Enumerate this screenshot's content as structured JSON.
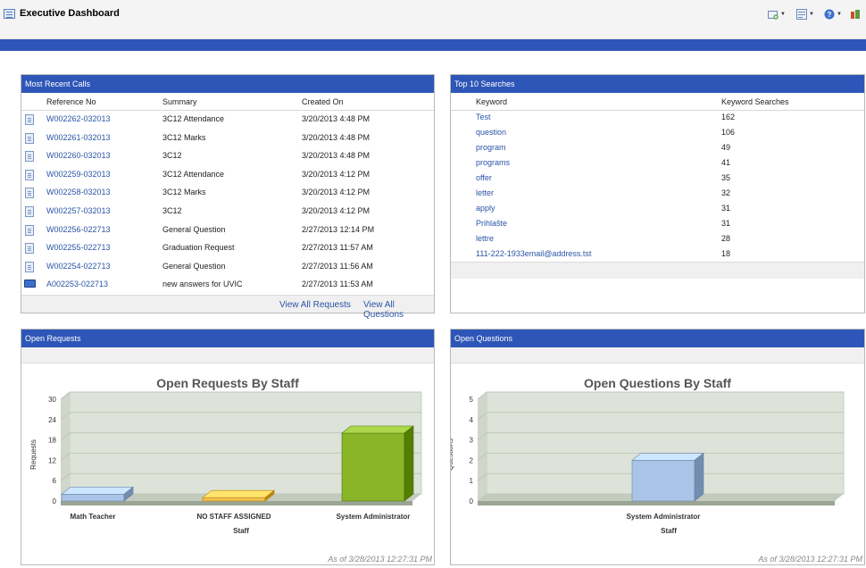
{
  "app": {
    "title": "Executive Dashboard"
  },
  "toolbar": {
    "buttons": [
      "add-icon",
      "export-icon",
      "help-icon",
      "settings-icon"
    ]
  },
  "recent_calls": {
    "title": "Most Recent Calls",
    "columns": [
      "Reference No",
      "Summary",
      "Created On"
    ],
    "rows": [
      {
        "icon": "document-icon",
        "ref": "W002262-032013",
        "summary": "3C12 Attendance",
        "created": "3/20/2013 4:48 PM"
      },
      {
        "icon": "document-icon",
        "ref": "W002261-032013",
        "summary": "3C12 Marks",
        "created": "3/20/2013 4:48 PM"
      },
      {
        "icon": "document-icon",
        "ref": "W002260-032013",
        "summary": "3C12",
        "created": "3/20/2013 4:48 PM"
      },
      {
        "icon": "document-icon",
        "ref": "W002259-032013",
        "summary": "3C12 Attendance",
        "created": "3/20/2013 4:12 PM"
      },
      {
        "icon": "document-icon",
        "ref": "W002258-032013",
        "summary": "3C12 Marks",
        "created": "3/20/2013 4:12 PM"
      },
      {
        "icon": "document-icon",
        "ref": "W002257-032013",
        "summary": "3C12",
        "created": "3/20/2013 4:12 PM"
      },
      {
        "icon": "document-icon",
        "ref": "W002256-022713",
        "summary": "General Question",
        "created": "2/27/2013 12:14 PM"
      },
      {
        "icon": "document-icon",
        "ref": "W002255-022713",
        "summary": "Graduation Request",
        "created": "2/27/2013 11:57 AM"
      },
      {
        "icon": "document-icon",
        "ref": "W002254-022713",
        "summary": "General Question",
        "created": "2/27/2013 11:56 AM"
      },
      {
        "icon": "book-icon",
        "ref": "A002253-022713",
        "summary": "new answers for UVIC",
        "created": "2/27/2013 11:53 AM"
      }
    ],
    "view_all_requests": "View All Requests",
    "view_all_questions": "View All Questions"
  },
  "top_searches": {
    "title": "Top 10 Searches",
    "columns": [
      "Keyword",
      "Keyword Searches"
    ],
    "rows": [
      {
        "keyword": "Test",
        "count": "162"
      },
      {
        "keyword": "question",
        "count": "106"
      },
      {
        "keyword": "program",
        "count": "49"
      },
      {
        "keyword": "programs",
        "count": "41"
      },
      {
        "keyword": "offer",
        "count": "35"
      },
      {
        "keyword": "letter",
        "count": "32"
      },
      {
        "keyword": "apply",
        "count": "31"
      },
      {
        "keyword": "Prihlašte",
        "count": "31"
      },
      {
        "keyword": "lettre",
        "count": "28"
      },
      {
        "keyword": "111-222-1933email@address.tst",
        "count": "18"
      }
    ]
  },
  "open_requests": {
    "title": "Open Requests",
    "as_of": "As of 3/28/2013 12:27:31 PM"
  },
  "open_questions": {
    "title": "Open Questions",
    "as_of": "As of 3/28/2013 12:27:31 PM"
  },
  "chart_data": [
    {
      "type": "bar",
      "title": "Open Requests By Staff",
      "xlabel": "Staff",
      "ylabel": "Requests",
      "categories": [
        "Math Teacher",
        "NO STAFF ASSIGNED",
        "System Administrator"
      ],
      "values": [
        2,
        1,
        20
      ],
      "ylim": [
        0,
        30
      ],
      "yticks": [
        0,
        6,
        12,
        18,
        24,
        30
      ],
      "colors": [
        "#a9c4e6",
        "#f2c14a",
        "#8ab529"
      ],
      "grid": true
    },
    {
      "type": "bar",
      "title": "Open Questions By Staff",
      "xlabel": "Staff",
      "ylabel": "Questions",
      "categories": [
        "System Administrator"
      ],
      "values": [
        2
      ],
      "ylim": [
        0,
        5
      ],
      "yticks": [
        0,
        1,
        2,
        3,
        4,
        5
      ],
      "colors": [
        "#a9c4e6"
      ],
      "grid": true
    }
  ]
}
